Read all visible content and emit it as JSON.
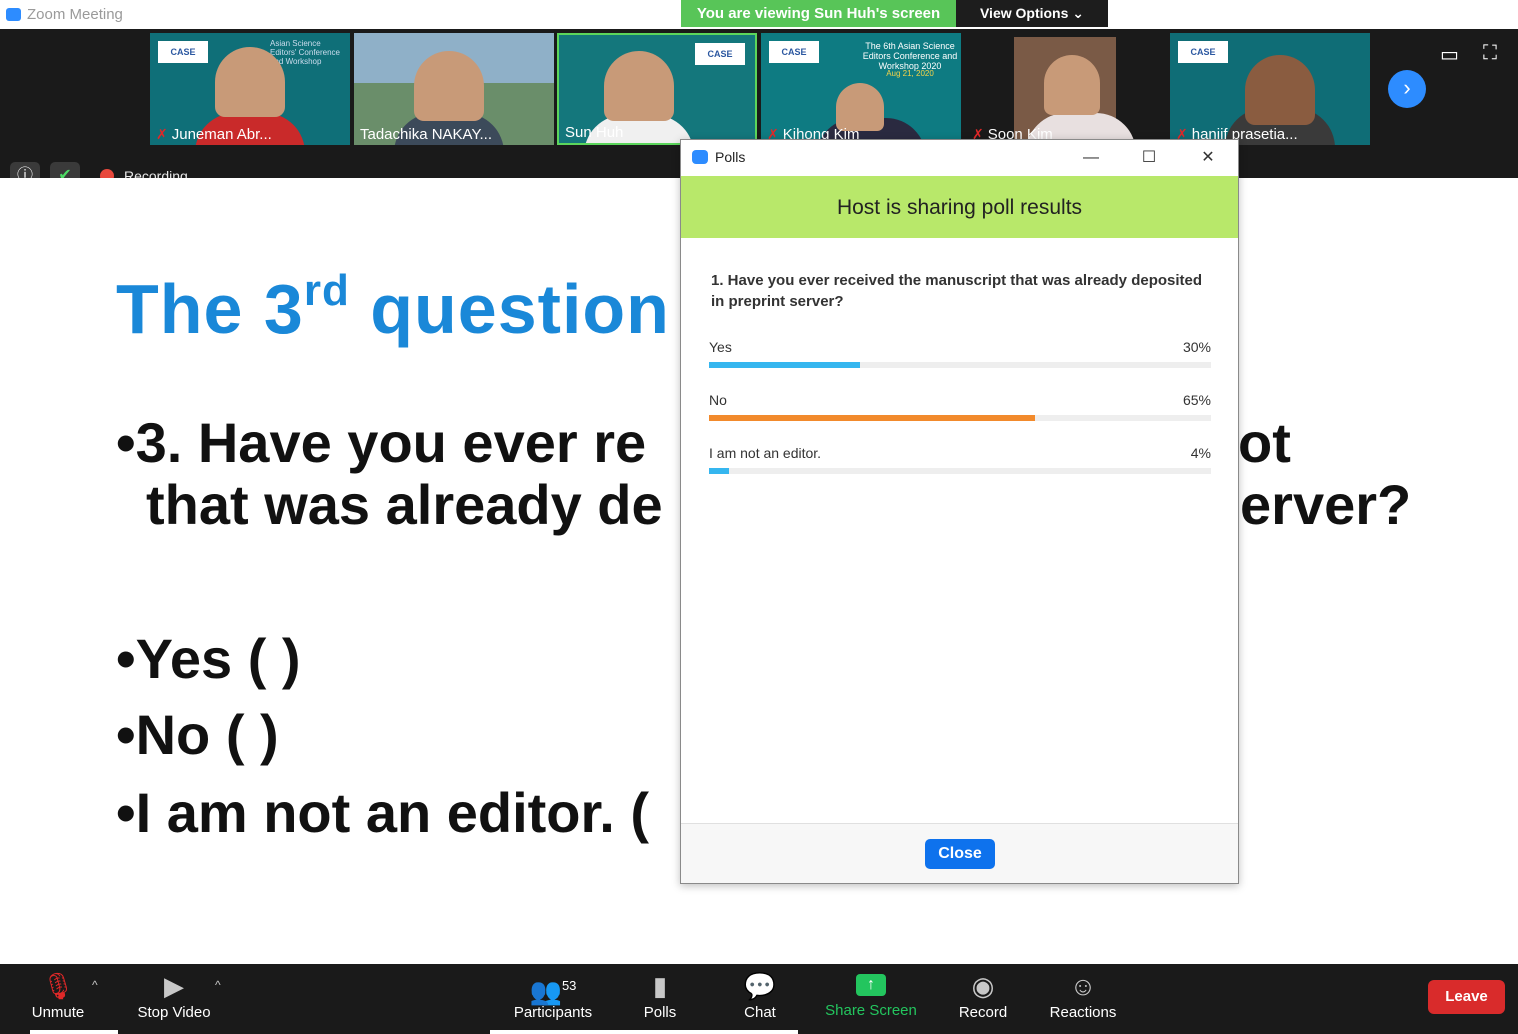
{
  "window": {
    "title": "Zoom Meeting"
  },
  "banner": {
    "viewing": "You are viewing Sun Huh's screen",
    "view_options": "View Options ⌄"
  },
  "participants_strip": [
    {
      "name": "Juneman Abr...",
      "muted": true,
      "bg": "#0f6f78"
    },
    {
      "name": "Tadachika NAKAY...",
      "muted": false,
      "bg": "#6a8e6a"
    },
    {
      "name": "Sun Huh",
      "muted": false,
      "bg": "#14777c"
    },
    {
      "name": "Kihong Kim",
      "muted": true,
      "bg": "#0e7b82"
    },
    {
      "name": "Soon Kim",
      "muted": true,
      "bg": "#5a4a3e"
    },
    {
      "name": "haniif prasetia...",
      "muted": true,
      "bg": "#0f6d76"
    }
  ],
  "strip_logo": "CASE",
  "strip_text": {
    "tile1": "Asian Science Editors' Conference and Workshop",
    "tile4": "The 6th Asian Science Editors Conference and Workshop 2020",
    "tile4_date": "Aug 21, 2020"
  },
  "recording": {
    "label": "Recording"
  },
  "slide": {
    "title_main": "The 3",
    "title_sup": "rd",
    "title_rest": " question",
    "question_line1": "•3. Have you ever re",
    "question_line1_end": "ot",
    "question_line2": "that was already de",
    "question_line2_end": "erver?",
    "bullet_yes": "•Yes (    )",
    "bullet_no": "•No (    )",
    "bullet_not_editor": "•I am not an editor. ("
  },
  "polls": {
    "title": "Polls",
    "banner": "Host is sharing poll results",
    "question": "1. Have you ever received the manuscript that was already deposited in preprint server?",
    "options": [
      {
        "label": "Yes",
        "percent_label": "30%",
        "percent": 30,
        "color": "#35b6ef"
      },
      {
        "label": "No",
        "percent_label": "65%",
        "percent": 65,
        "color": "#f28a2c"
      },
      {
        "label": "I am not an editor.",
        "percent_label": "4%",
        "percent": 4,
        "color": "#35b6ef"
      }
    ],
    "close_label": "Close"
  },
  "toolbar": {
    "unmute": "Unmute",
    "stop_video": "Stop Video",
    "participants": "Participants",
    "participants_count": "53",
    "polls": "Polls",
    "chat": "Chat",
    "share_screen": "Share Screen",
    "record": "Record",
    "reactions": "Reactions",
    "leave": "Leave"
  }
}
